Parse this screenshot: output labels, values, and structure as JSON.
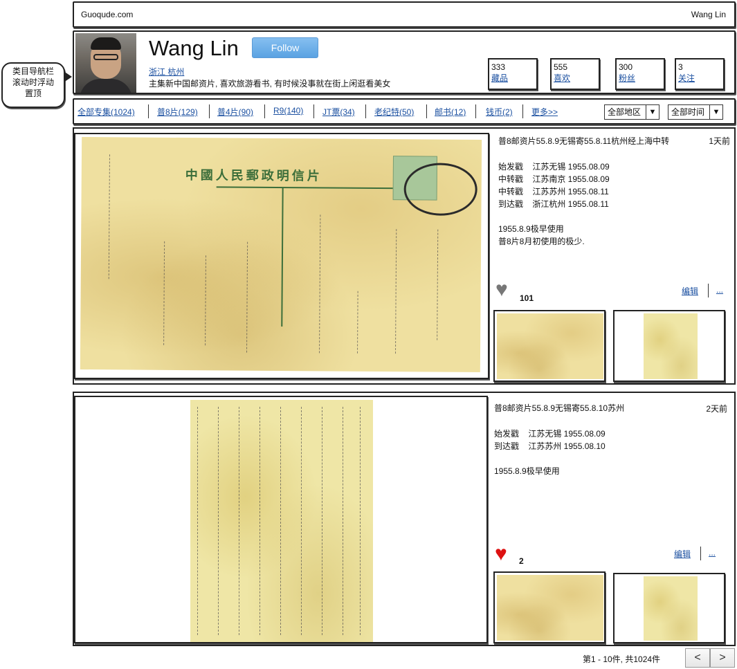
{
  "topbar": {
    "site_name": "Guoqude.com",
    "user_name": "Wang Lin"
  },
  "callout": {
    "lines": [
      "类目导航栏",
      "滚动时浮动",
      "置顶"
    ]
  },
  "profile": {
    "name": "Wang Lin",
    "follow_label": "Follow",
    "location": "浙江 杭州",
    "bio": "主集新中国邮资片, 喜欢旅游看书, 有时候没事就在街上闲逛看美女",
    "stats": [
      {
        "value": "333",
        "label": "藏品"
      },
      {
        "value": "555",
        "label": "喜欢"
      },
      {
        "value": "300",
        "label": "粉丝"
      },
      {
        "value": "3",
        "label": "关注"
      }
    ]
  },
  "nav": {
    "items": [
      "全部专集(1024)",
      "普8片(129)",
      "普4片(90)",
      "R9(140)",
      "JT票(34)",
      "老纪特(50)",
      "邮书(12)",
      "钱币(2)",
      "更多>>"
    ],
    "region_select": "全部地区",
    "time_select": "全部时间",
    "arrow_glyph": "▼"
  },
  "posts": [
    {
      "title": "普8邮资片55.8.9无锡寄55.8.11杭州经上海中转",
      "age": "1天前",
      "details": [
        "始发戳    江苏无锡 1955.08.09",
        "中转戳    江苏南京 1955.08.09",
        "中转戳    江苏苏州 1955.08.11",
        "到达戳    浙江杭州 1955.08.11"
      ],
      "notes": [
        "1955.8.9极早使用",
        "普8片8月初使用的极少."
      ],
      "likes": "101",
      "liked": false,
      "heart_color": "#777777",
      "edit_label": "编辑",
      "more_label": "...",
      "card_heading": "中國人民郵政明信片"
    },
    {
      "title": "普8邮资片55.8.9无锡寄55.8.10苏州",
      "age": "2天前",
      "details": [
        "始发戳    江苏无锡 1955.08.09",
        "到达戳    江苏苏州 1955.08.10"
      ],
      "notes": [
        "1955.8.9极早使用"
      ],
      "likes": "2",
      "liked": true,
      "heart_color": "#dd1111",
      "edit_label": "编辑",
      "more_label": "..."
    }
  ],
  "pager": {
    "text": "第1 - 10件, 共1024件",
    "prev": "<",
    "next": ">"
  },
  "icons": {
    "heart": "♥",
    "prev": "chevron-left-icon",
    "next": "chevron-right-icon"
  }
}
